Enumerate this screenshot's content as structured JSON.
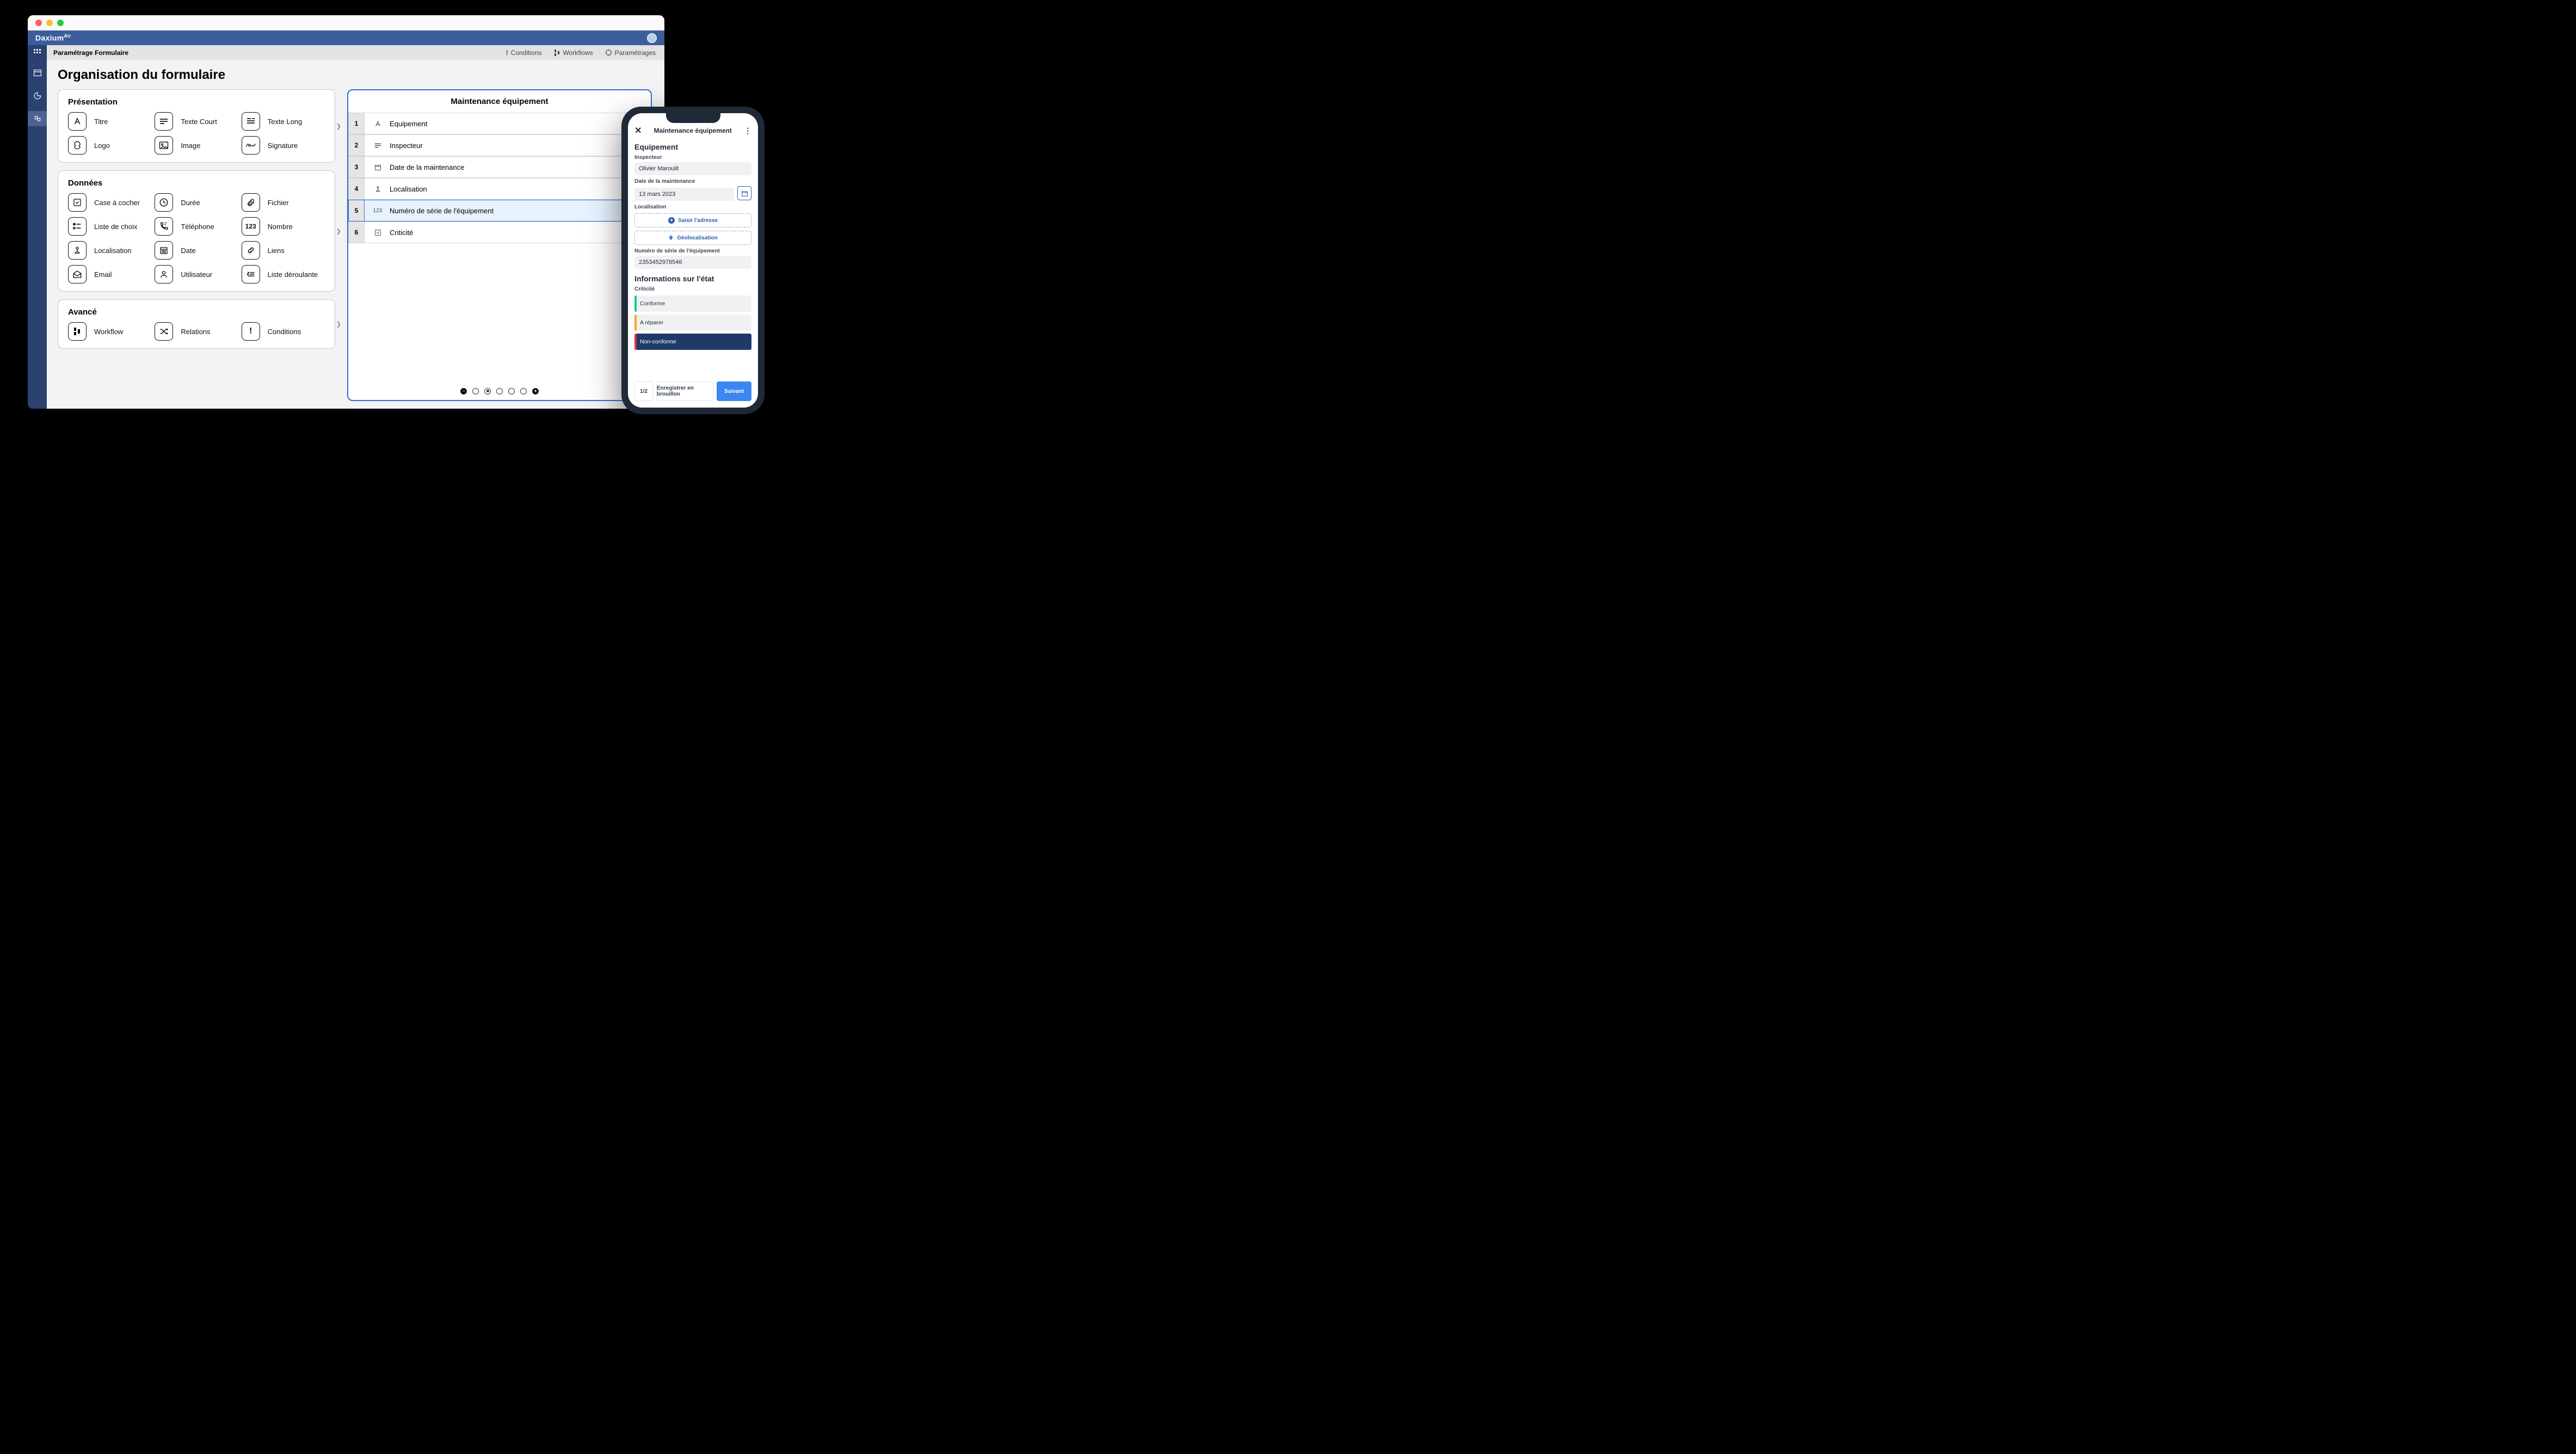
{
  "app": {
    "brand": "Daxium"
  },
  "ribbon": {
    "title": "Paramétrage Formulaire",
    "actions": {
      "conditions": "Conditions",
      "workflows": "Workflows",
      "settings": "Paramétrages"
    }
  },
  "page": {
    "title": "Organisation du formulaire"
  },
  "palette": {
    "presentation": {
      "title": "Présentation",
      "items": {
        "title": "Titre",
        "shortText": "Texte Court",
        "longText": "Texte Long",
        "logo": "Logo",
        "image": "Image",
        "signature": "Signature"
      }
    },
    "data": {
      "title": "Données",
      "items": {
        "checkbox": "Case à cocher",
        "duration": "Durée",
        "file": "Fichier",
        "choiceList": "Liste de choix",
        "phone": "Téléphone",
        "number": "Nombre",
        "location": "Localisation",
        "date": "Date",
        "links": "Liens",
        "email": "Email",
        "user": "Utilisateur",
        "dropdown": "Liste déroulante"
      }
    },
    "advanced": {
      "title": "Avancé",
      "items": {
        "workflow": "Workflow",
        "relations": "Relations",
        "conditions": "Conditions"
      }
    }
  },
  "preview": {
    "title": "Maintenance équipement",
    "rows": {
      "r1": {
        "num": "1",
        "label": "Equipement"
      },
      "r2": {
        "num": "2",
        "label": "Inspecteur"
      },
      "r3": {
        "num": "3",
        "label": "Date de la maintenance"
      },
      "r4": {
        "num": "4",
        "label": "Localisation"
      },
      "r5": {
        "num": "5",
        "label": "Numéro de série de l'équipement"
      },
      "r6": {
        "num": "6",
        "label": "Criticité"
      }
    }
  },
  "phone": {
    "title": "Maintenance équipement",
    "section1": "Equipement",
    "inspectorLabel": "Inspecteur",
    "inspectorValue": "Olivier Maroulit",
    "dateLabel": "Date de la maintenance",
    "dateValue": "13 mars 2023",
    "locationLabel": "Localisation",
    "addressBtn": "Saisir l'adresse",
    "geoBtn": "Géolocalisation",
    "serialLabel": "Numéro de série de l'équipement",
    "serialValue": "2353452978546",
    "section2": "Informations sur l'état",
    "critLabel": "Criticité",
    "crit1": "Conforme",
    "crit2": "A réparer",
    "crit3": "Non-conforme",
    "footer": {
      "page": "1/2",
      "save": "Enregistrer en brouillon",
      "next": "Suivant"
    }
  }
}
